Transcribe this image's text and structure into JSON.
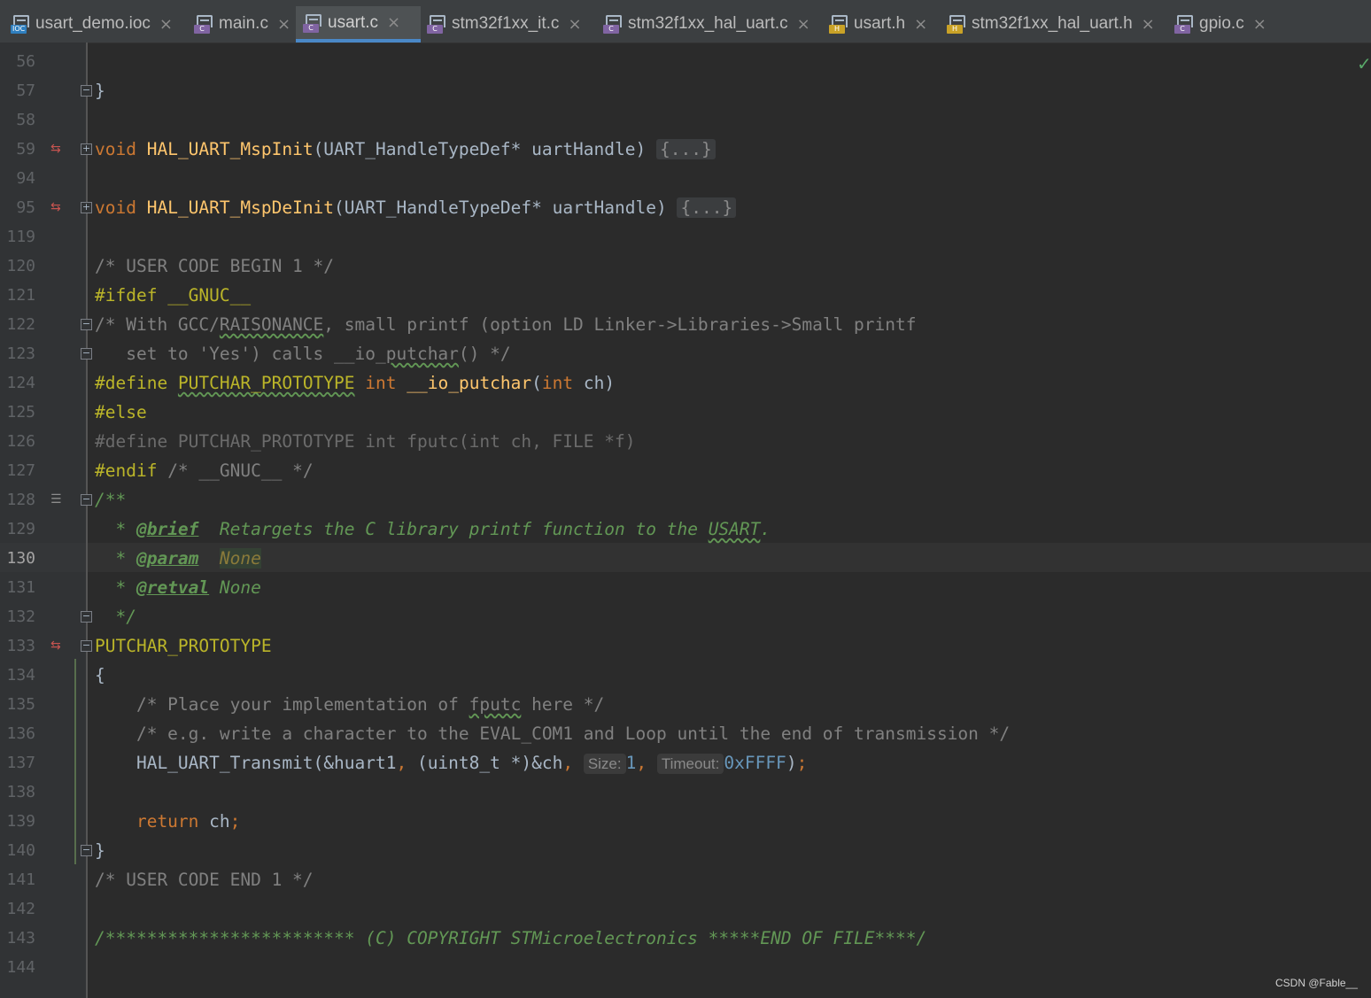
{
  "tabs": [
    {
      "name": "usart_demo.ioc",
      "type": "IOC",
      "color": "#2f7fbf",
      "active": false
    },
    {
      "name": "main.c",
      "type": "C",
      "color": "#8064a2",
      "active": false
    },
    {
      "name": "usart.c",
      "type": "C",
      "color": "#8064a2",
      "active": true
    },
    {
      "name": "stm32f1xx_it.c",
      "type": "C",
      "color": "#8064a2",
      "active": false
    },
    {
      "name": "stm32f1xx_hal_uart.c",
      "type": "C",
      "color": "#8064a2",
      "active": false
    },
    {
      "name": "usart.h",
      "type": "H",
      "color": "#c9a227",
      "active": false
    },
    {
      "name": "stm32f1xx_hal_uart.h",
      "type": "H",
      "color": "#c9a227",
      "active": false
    },
    {
      "name": "gpio.c",
      "type": "C",
      "color": "#8064a2",
      "active": false
    }
  ],
  "tab_close_glyph": "×",
  "current_line": "130",
  "lines": {
    "l56": {
      "n": "56"
    },
    "l57": {
      "n": "57",
      "text": "}"
    },
    "l58": {
      "n": "58"
    },
    "l59": {
      "n": "59",
      "kw": "void",
      "fn": "HAL_UART_MspInit",
      "args": "(UART_HandleTypeDef* uartHandle)",
      "folded": "{...}"
    },
    "l94": {
      "n": "94"
    },
    "l95": {
      "n": "95",
      "kw": "void",
      "fn": "HAL_UART_MspDeInit",
      "args": "(UART_HandleTypeDef* uartHandle)",
      "folded": "{...}"
    },
    "l119": {
      "n": "119"
    },
    "l120": {
      "n": "120",
      "text": "/* USER CODE BEGIN 1 */"
    },
    "l121": {
      "n": "121",
      "pp": "#ifdef",
      "rest": " __GNUC__"
    },
    "l122": {
      "n": "122",
      "a": "/* With GCC/",
      "typo": "RAISONANCE",
      "b": ", small printf (option LD Linker->Libraries->Small printf"
    },
    "l123": {
      "n": "123",
      "a": "   set to 'Yes') calls __io_",
      "typo": "putchar",
      "b": "() */"
    },
    "l124": {
      "n": "124",
      "pp": "#define",
      "mac": "PUTCHAR_PROTOTYPE",
      "kw1": "int",
      "fn": "__io_putchar",
      "p1": "(",
      "kw2": "int",
      "p2": " ch)"
    },
    "l125": {
      "n": "125",
      "pp": "#else"
    },
    "l126": {
      "n": "126",
      "text": "#define PUTCHAR_PROTOTYPE int fputc(int ch, FILE *f)"
    },
    "l127": {
      "n": "127",
      "pp": "#endif",
      "cm": " /* __GNUC__ */"
    },
    "l128": {
      "n": "128",
      "text": "/**"
    },
    "l129": {
      "n": "129",
      "star": "  * ",
      "tag": "@brief",
      "a": "  Retargets the C library printf function to the ",
      "typo": "USART",
      "b": "."
    },
    "l130": {
      "n": "130",
      "star": "  * ",
      "tag": "@param",
      "gap": "  ",
      "val": "None"
    },
    "l131": {
      "n": "131",
      "star": "  * ",
      "tag": "@retval",
      "val": " None"
    },
    "l132": {
      "n": "132",
      "text": "  */"
    },
    "l133": {
      "n": "133",
      "mac": "PUTCHAR_PROTOTYPE"
    },
    "l134": {
      "n": "134",
      "text": "{"
    },
    "l135": {
      "n": "135",
      "a": "    /* Place your implementation of ",
      "typo": "fputc",
      "b": " here */"
    },
    "l136": {
      "n": "136",
      "text": "    /* e.g. write a character to the EVAL_COM1 and Loop until the end of transmission */"
    },
    "l137": {
      "n": "137",
      "a": "    HAL_UART_Transmit(&huart1",
      "comma1": ", ",
      "b": "(uint8_t *)&ch",
      "comma2": ", ",
      "hint1": "Size:",
      "num1": "1",
      "comma3": ", ",
      "hint2": "Timeout:",
      "num2": "0xFFFF",
      "c": ")",
      "semi": ";"
    },
    "l138": {
      "n": "138"
    },
    "l139": {
      "n": "139",
      "kw": "    return",
      "rest": " ch",
      "semi": ";"
    },
    "l140": {
      "n": "140",
      "text": "}"
    },
    "l141": {
      "n": "141",
      "text": "/* USER CODE END 1 */"
    },
    "l142": {
      "n": "142"
    },
    "l143": {
      "n": "143",
      "text": "/************************ (C) COPYRIGHT STMicroelectronics *****END OF FILE****/"
    },
    "l144": {
      "n": "144"
    }
  },
  "status_check_glyph": "✓",
  "watermark": "CSDN @Fable__"
}
